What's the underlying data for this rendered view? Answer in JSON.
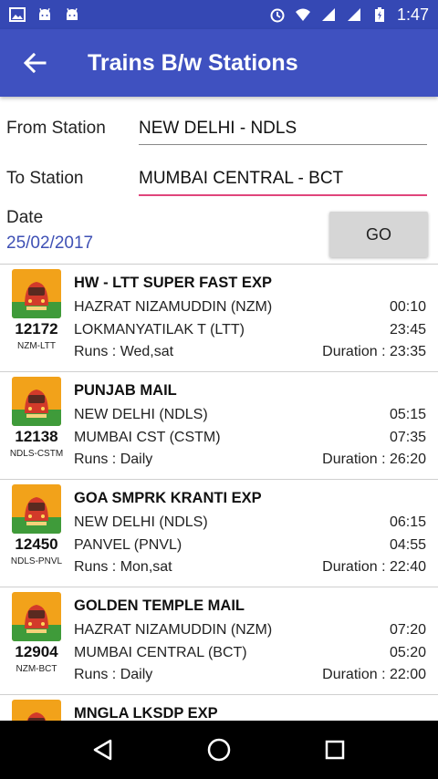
{
  "status_bar": {
    "time": "1:47"
  },
  "app_bar": {
    "title": "Trains B/w Stations"
  },
  "form": {
    "from_label": "From Station",
    "from_value": "NEW DELHI - NDLS",
    "to_label": "To Station",
    "to_value": "MUMBAI CENTRAL - BCT",
    "date_label": "Date",
    "date_value": "25/02/2017",
    "go_label": "GO"
  },
  "trains": [
    {
      "name": "HW - LTT SUPER FAST EXP",
      "number": "12172",
      "code": "NZM-LTT",
      "from": "HAZRAT NIZAMUDDIN (NZM)",
      "dep": "00:10",
      "to": "LOKMANYATILAK T (LTT)",
      "arr": "23:45",
      "runs": "Runs : Wed,sat",
      "duration": "Duration : 23:35"
    },
    {
      "name": "PUNJAB MAIL",
      "number": "12138",
      "code": "NDLS-CSTM",
      "from": "NEW DELHI (NDLS)",
      "dep": "05:15",
      "to": "MUMBAI CST (CSTM)",
      "arr": "07:35",
      "runs": "Runs : Daily",
      "duration": "Duration : 26:20"
    },
    {
      "name": "GOA SMPRK KRANTI EXP",
      "number": "12450",
      "code": "NDLS-PNVL",
      "from": "NEW DELHI (NDLS)",
      "dep": "06:15",
      "to": "PANVEL (PNVL)",
      "arr": "04:55",
      "runs": "Runs : Mon,sat",
      "duration": "Duration : 22:40"
    },
    {
      "name": "GOLDEN TEMPLE MAIL",
      "number": "12904",
      "code": "NZM-BCT",
      "from": "HAZRAT NIZAMUDDIN (NZM)",
      "dep": "07:20",
      "to": "MUMBAI CENTRAL (BCT)",
      "arr": "05:20",
      "runs": "Runs : Daily",
      "duration": "Duration : 22:00"
    },
    {
      "name": "MNGLA LKSDP EXP",
      "number": "",
      "code": "",
      "from": "",
      "dep": "",
      "to": "",
      "arr": "",
      "runs": "",
      "duration": ""
    }
  ],
  "colors": {
    "app_bar": "#3f51c0",
    "status_bar": "#3548b4",
    "accent": "#e0457b",
    "date": "#3f51b5"
  }
}
